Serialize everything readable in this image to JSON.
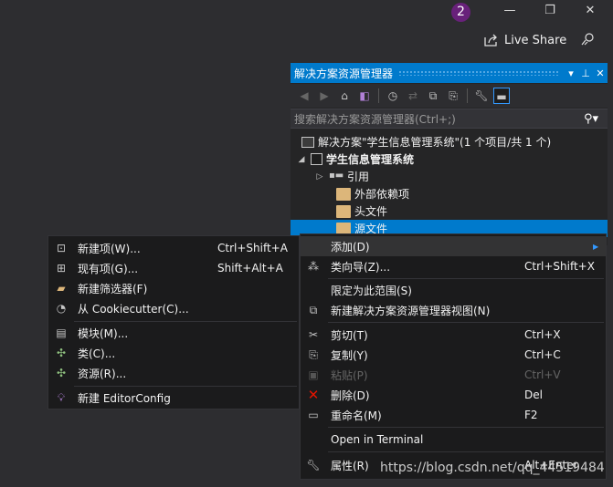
{
  "titlebar": {
    "notification_count": "2",
    "minimize": "—",
    "maximize": "❐",
    "close": "✕",
    "live_share": "Live Share"
  },
  "solution_explorer": {
    "title": "解决方案资源管理器",
    "search_placeholder": "搜索解决方案资源管理器(Ctrl+;)",
    "solution": "解决方案\"学生信息管理系统\"(1 个项目/共 1 个)",
    "project": "学生信息管理系统",
    "references": "引用",
    "external_deps": "外部依赖项",
    "header_files": "头文件",
    "source_files": "源文件"
  },
  "submenu": {
    "items": [
      {
        "label": "新建项(W)...",
        "shortcut": "Ctrl+Shift+A",
        "icon": "new-item-icon"
      },
      {
        "label": "现有项(G)...",
        "shortcut": "Shift+Alt+A",
        "icon": "existing-item-icon"
      },
      {
        "label": "新建筛选器(F)",
        "shortcut": "",
        "icon": "new-filter-icon"
      },
      {
        "label": "从 Cookiecutter(C)...",
        "shortcut": "",
        "icon": "cookiecutter-icon"
      },
      {
        "label": "模块(M)...",
        "shortcut": "",
        "icon": "module-icon"
      },
      {
        "label": "类(C)...",
        "shortcut": "",
        "icon": "class-icon"
      },
      {
        "label": "资源(R)...",
        "shortcut": "",
        "icon": "resource-icon"
      },
      {
        "label": "新建 EditorConfig",
        "shortcut": "",
        "icon": "editorconfig-icon"
      }
    ]
  },
  "context_menu": {
    "items": [
      {
        "label": "添加(D)",
        "shortcut": "",
        "icon": "",
        "submenu": true
      },
      {
        "label": "类向导(Z)...",
        "shortcut": "Ctrl+Shift+X",
        "icon": "class-wizard-icon"
      },
      {
        "label": "限定为此范围(S)",
        "shortcut": "",
        "icon": ""
      },
      {
        "label": "新建解决方案资源管理器视图(N)",
        "shortcut": "",
        "icon": "new-view-icon"
      },
      {
        "label": "剪切(T)",
        "shortcut": "Ctrl+X",
        "icon": "cut-icon"
      },
      {
        "label": "复制(Y)",
        "shortcut": "Ctrl+C",
        "icon": "copy-icon"
      },
      {
        "label": "粘贴(P)",
        "shortcut": "Ctrl+V",
        "icon": "paste-icon",
        "disabled": true
      },
      {
        "label": "删除(D)",
        "shortcut": "Del",
        "icon": "delete-icon"
      },
      {
        "label": "重命名(M)",
        "shortcut": "F2",
        "icon": "rename-icon"
      },
      {
        "label": "Open in Terminal",
        "shortcut": "",
        "icon": ""
      },
      {
        "label": "属性(R)",
        "shortcut": "Alt+Enter",
        "icon": "properties-icon"
      }
    ]
  },
  "watermark": "https://blog.csdn.net/qq_44519484",
  "colors": {
    "accent": "#007acc",
    "background": "#2d2d30",
    "menu_bg": "#1b1b1c",
    "badge": "#68217a",
    "delete_red": "#e51400"
  }
}
